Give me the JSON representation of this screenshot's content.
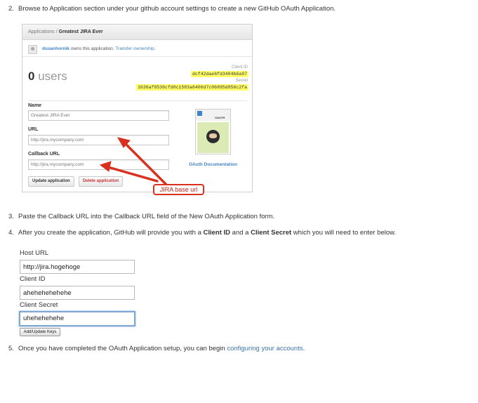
{
  "steps": {
    "s2": {
      "num": "2.",
      "text": "Browse to Application section under your github account settings to create a new GitHub OAuth Application."
    },
    "s3": {
      "num": "3.",
      "text": "Paste the Callback URL into the Callback URL field of the New OAuth Application form."
    },
    "s4": {
      "num": "4.",
      "pre": "After you create the application, GitHub will provide you with a ",
      "b1": "Client ID",
      "mid": " and a ",
      "b2": "Client Secret",
      "post": " which you will need to enter below."
    },
    "s5": {
      "num": "5.",
      "pre": "Once you have completed the OAuth Application setup, you can begin ",
      "link": "configuring your accounts",
      "post": "."
    }
  },
  "github": {
    "breadcrumb_root": "Applications / ",
    "breadcrumb_app": "Greatest JIRA Ever",
    "owner_user": "dusanhornik",
    "owner_text": " owns this application. ",
    "transfer_link": "Transfer ownership.",
    "users_count": "0",
    "users_word": " users",
    "client_id_label": "Client ID",
    "client_id": "dcf42dae6fd3404b6a97",
    "secret_label": "Secret",
    "secret": "1636af8536cfd0c1583a6400d7c06895d856c2fa",
    "name_label": "Name",
    "name_value": "Greatest JIRA Ever",
    "url_label": "URL",
    "url_value": "http://jira.mycompany.com",
    "callback_label": "Callback URL",
    "callback_value": "http://jira.mycompany.com",
    "update_button": "Update application",
    "delete_button": "Delete application",
    "oauth_img_title": "OAUTH",
    "oauth_doc_link": "OAuth Documentation",
    "callout": "JIRA base url",
    "callout_color": "#d9301f"
  },
  "form": {
    "host_url_label": "Host URL",
    "host_url_value": "http://jira.hogehoge",
    "client_id_label": "Client ID",
    "client_id_value": "ahehehehehehe",
    "client_secret_label": "Client Secret",
    "client_secret_value": "uhehehehehe",
    "add_button": "Add/Update Keys"
  },
  "colors": {
    "link": "#3b73af",
    "highlight": "#ffff66",
    "focus_border": "#7ea7d4"
  }
}
